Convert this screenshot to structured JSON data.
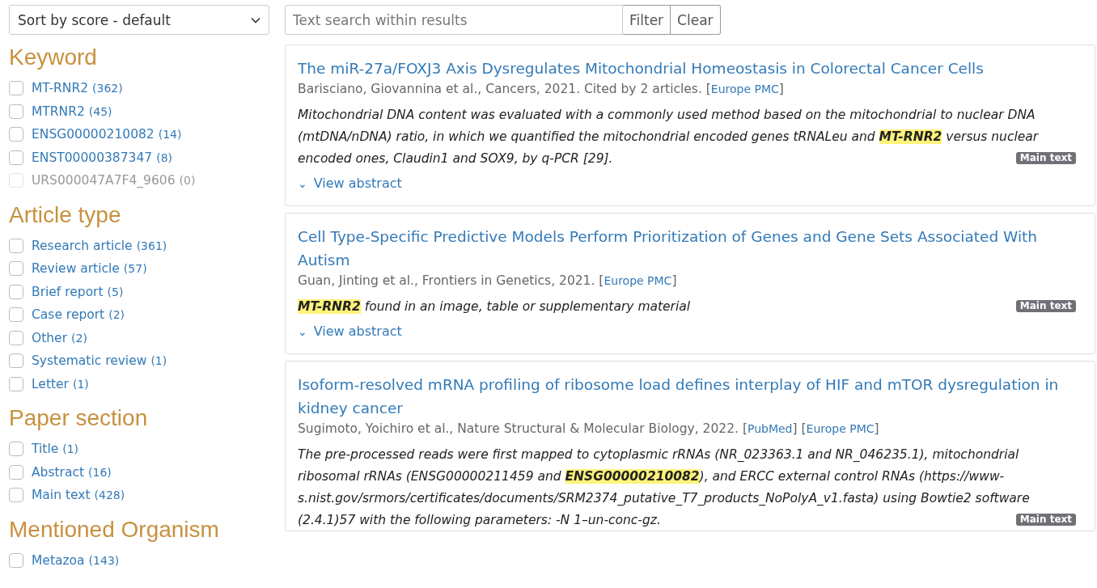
{
  "sort_select": {
    "value": "Sort by score - default"
  },
  "search": {
    "placeholder": "Text search within results",
    "buttons": [
      "Filter",
      "Clear"
    ]
  },
  "facets": [
    {
      "title": "Keyword",
      "items": [
        {
          "label": "MT-RNR2",
          "count": "(362)",
          "checked": false,
          "disabled": false
        },
        {
          "label": "MTRNR2",
          "count": "(45)",
          "checked": false,
          "disabled": false
        },
        {
          "label": "ENSG00000210082",
          "count": "(14)",
          "checked": false,
          "disabled": false
        },
        {
          "label": "ENST00000387347",
          "count": "(8)",
          "checked": false,
          "disabled": false
        },
        {
          "label": "URS000047A7F4_9606",
          "count": "(0)",
          "checked": false,
          "disabled": true
        }
      ]
    },
    {
      "title": "Article type",
      "items": [
        {
          "label": "Research article",
          "count": "(361)",
          "checked": false,
          "disabled": false
        },
        {
          "label": "Review article",
          "count": "(57)",
          "checked": false,
          "disabled": false
        },
        {
          "label": "Brief report",
          "count": "(5)",
          "checked": false,
          "disabled": false
        },
        {
          "label": "Case report",
          "count": "(2)",
          "checked": false,
          "disabled": false
        },
        {
          "label": "Other",
          "count": "(2)",
          "checked": false,
          "disabled": false
        },
        {
          "label": "Systematic review",
          "count": "(1)",
          "checked": false,
          "disabled": false
        },
        {
          "label": "Letter",
          "count": "(1)",
          "checked": false,
          "disabled": false
        }
      ]
    },
    {
      "title": "Paper section",
      "items": [
        {
          "label": "Title",
          "count": "(1)",
          "checked": false,
          "disabled": false
        },
        {
          "label": "Abstract",
          "count": "(16)",
          "checked": false,
          "disabled": false
        },
        {
          "label": "Main text",
          "count": "(428)",
          "checked": false,
          "disabled": false
        }
      ]
    },
    {
      "title": "Mentioned Organism",
      "items": [
        {
          "label": "Metazoa",
          "count": "(143)",
          "checked": false,
          "disabled": false
        }
      ]
    }
  ],
  "results": [
    {
      "title": "The miR-27a/FOXJ3 Axis Dysregulates Mitochondrial Homeostasis in Colorectal Cancer Cells",
      "meta": "Barisciano, Giovannina et al., Cancers, 2021. Cited by 2 articles.",
      "sources": [
        {
          "open": "[",
          "label": "Europe PMC",
          "close": "]"
        }
      ],
      "snippet": "Mitochondrial DNA content was evaluated with a commonly used method based on the mitochondrial to nuclear DNA (mtDNA/nDNA) ratio, in which we quantified the mitochondrial encoded genes tRNALeu and **MT-RNR2** versus nuclear encoded ones, Claudin1 and SOX9, by q-PCR [29].",
      "badge": "Main text",
      "abstract_toggle": {
        "icon": "⌄",
        "label": "View abstract"
      }
    },
    {
      "title": "Cell Type-Specific Predictive Models Perform Prioritization of Genes and Gene Sets Associated With Autism",
      "meta": "Guan, Jinting et al., Frontiers in Genetics, 2021.",
      "sources": [
        {
          "open": "[",
          "label": "Europe PMC",
          "close": "]"
        }
      ],
      "snippet": "**MT-RNR2** found in an image, table or supplementary material",
      "badge": "Main text",
      "abstract_toggle": {
        "icon": "⌄",
        "label": "View abstract"
      }
    },
    {
      "title": "Isoform-resolved mRNA profiling of ribosome load defines interplay of HIF and mTOR dysregulation in kidney cancer",
      "meta": "Sugimoto, Yoichiro et al., Nature Structural & Molecular Biology, 2022.",
      "sources": [
        {
          "open": "[",
          "label": "PubMed",
          "close": "]"
        },
        {
          "open": "[",
          "label": "Europe PMC",
          "close": "]"
        }
      ],
      "snippet": "The pre-processed reads were first mapped to cytoplasmic rRNAs (NR_023363.1 and NR_046235.1), mitochondrial ribosomal rRNAs (ENSG00000211459 and **ENSG00000210082**), and ERCC external control RNAs (https://www-s.nist.gov/srmors/certificates/documents/SRM2374_putative_T7_products_NoPolyA_v1.fasta) using Bowtie2 software (2.4.1)57 with the following parameters: -N 1–un-conc-gz.",
      "badge": "Main text"
    }
  ]
}
